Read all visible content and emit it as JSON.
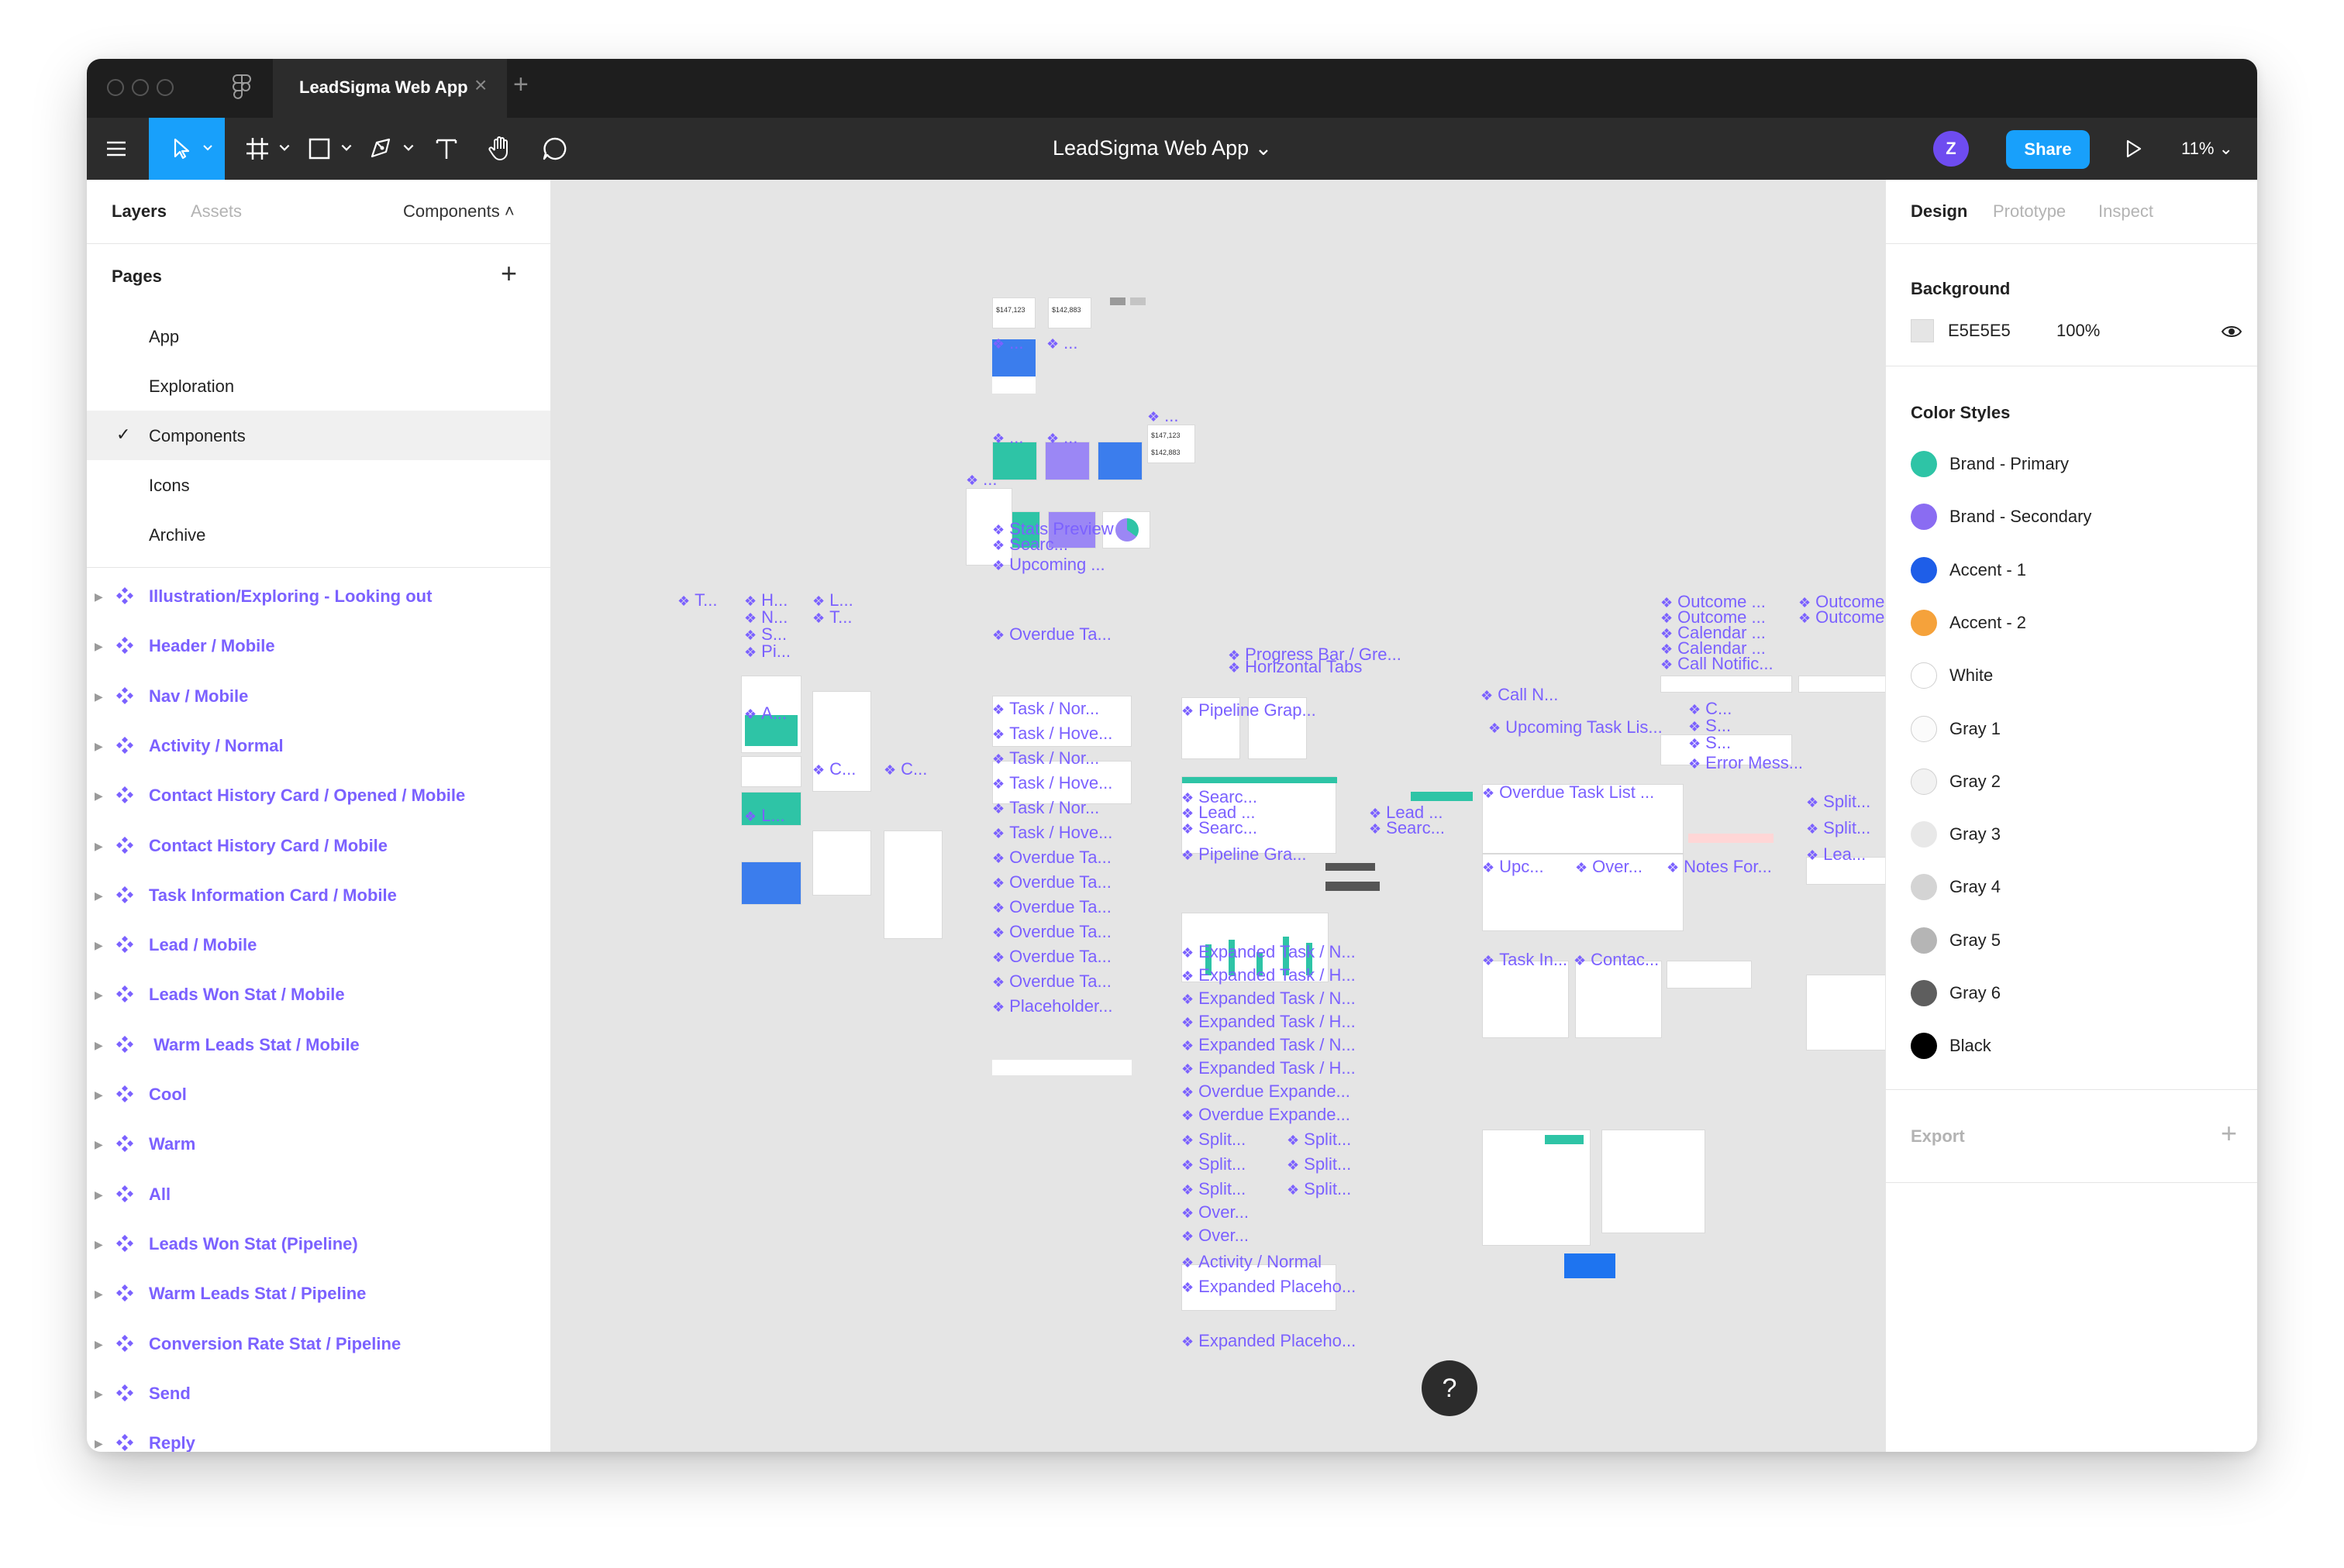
{
  "window": {
    "tab_title": "LeadSigma Web App",
    "doc_title": "LeadSigma Web App ⌄",
    "avatar_initial": "Z",
    "share_label": "Share",
    "zoom": "11% ⌄"
  },
  "left_panel": {
    "tabs": {
      "layers": "Layers",
      "assets": "Assets",
      "components": "Components ˄"
    },
    "pages_title": "Pages",
    "pages": [
      {
        "label": "App",
        "selected": false
      },
      {
        "label": "Exploration",
        "selected": false
      },
      {
        "label": "Components",
        "selected": true
      },
      {
        "label": "Icons",
        "selected": false
      },
      {
        "label": "Archive",
        "selected": false
      }
    ],
    "layers": [
      "Illustration/Exploring - Looking out",
      "Header / Mobile",
      "Nav / Mobile",
      "Activity / Normal",
      "Contact History Card / Opened / Mobile",
      "Contact History Card / Mobile",
      "Task Information Card / Mobile",
      "Lead / Mobile",
      "Leads Won Stat / Mobile",
      " Warm Leads Stat / Mobile",
      "Cool",
      "Warm",
      "All",
      "Leads Won Stat (Pipeline)",
      "Warm Leads Stat / Pipeline",
      "Conversion Rate Stat / Pipeline",
      "Send",
      "Reply"
    ]
  },
  "right_panel": {
    "tabs": {
      "design": "Design",
      "prototype": "Prototype",
      "inspect": "Inspect"
    },
    "background_title": "Background",
    "background_hex": "E5E5E5",
    "background_opacity": "100%",
    "color_styles_title": "Color Styles",
    "color_styles": [
      {
        "name": "Brand - Primary",
        "color": "#2ec4a6"
      },
      {
        "name": "Brand - Secondary",
        "color": "#8a6cf2"
      },
      {
        "name": "Accent - 1",
        "color": "#1e5ee8"
      },
      {
        "name": "Accent - 2",
        "color": "#f5a23b"
      },
      {
        "name": "White",
        "color": "#ffffff"
      },
      {
        "name": "Gray 1",
        "color": "#fbfbfb"
      },
      {
        "name": "Gray 2",
        "color": "#f2f2f2"
      },
      {
        "name": "Gray 3",
        "color": "#e8e8e8"
      },
      {
        "name": "Gray 4",
        "color": "#d4d4d4"
      },
      {
        "name": "Gray 5",
        "color": "#b5b5b5"
      },
      {
        "name": "Gray 6",
        "color": "#5e5e5e"
      },
      {
        "name": "Black",
        "color": "#000000"
      }
    ],
    "export_label": "Export"
  },
  "canvas": {
    "labels": [
      "...",
      "...",
      "...",
      "...",
      "...",
      "...",
      "Stats Preview",
      "Searc...",
      "Upcoming ...",
      "Overdue Ta...",
      "Task / Nor...",
      "Task / Hove...",
      "Task / Nor...",
      "Task / Hove...",
      "Task / Nor...",
      "Task / Hove...",
      "Overdue Ta...",
      "Overdue Ta...",
      "Overdue Ta...",
      "Overdue Ta...",
      "Overdue Ta...",
      "Overdue Ta...",
      "Placeholder...",
      "T...",
      "H...",
      "N...",
      "S...",
      "Pi...",
      "A...",
      "L...",
      "T...",
      "C...",
      "C...",
      "L...",
      "Progress Bar / Gre...",
      "Horizontal Tabs",
      "Pipeline Grap...",
      "Call N...",
      "Upcoming Task Lis...",
      "Searc...",
      "Lead ...",
      "Searc...",
      "Lead ...",
      "Searc...",
      "Pipeline Gra...",
      "Expanded Task / N...",
      "Expanded Task / H...",
      "Expanded Task / N...",
      "Expanded Task / H...",
      "Expanded Task / N...",
      "Expanded Task / H...",
      "Overdue Expande...",
      "Overdue Expande...",
      "Split...",
      "Split...",
      "Split...",
      "Split...",
      "Split...",
      "Split...",
      "Over...",
      "Over...",
      "Activity / Normal",
      "Expanded Placeho...",
      "Expanded Placeho...",
      "Overdue Task List ...",
      "Upc...",
      "Over...",
      "Notes For...",
      "Task In...",
      "Contac...",
      "Outcome ...",
      "Outcome ...",
      "Calendar ...",
      "Calendar ...",
      "Call Notific...",
      "Outcome ...",
      "Outcome ...",
      "C...",
      "S...",
      "S...",
      "Error Mess...",
      "Split...",
      "Split...",
      "Lea..."
    ],
    "stat_values": [
      "$147,123",
      "$142,883",
      "$147,123",
      "$142,883"
    ]
  },
  "help_label": "?"
}
